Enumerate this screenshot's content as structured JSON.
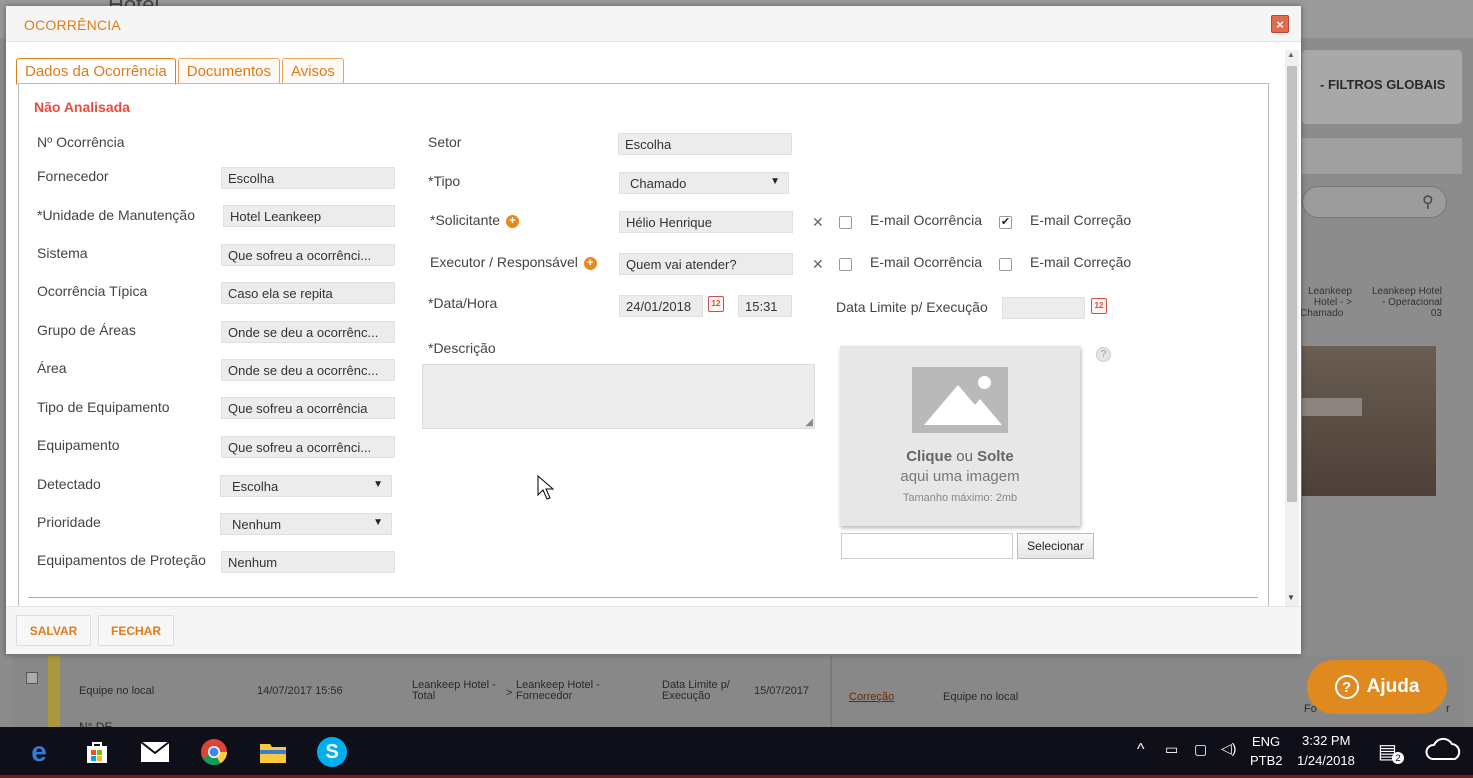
{
  "background": {
    "app_title": "Hotel",
    "filters_label": "- FILTROS GLOBAIS",
    "card_col1": [
      "Leankeep",
      "Hotel - >",
      "Chamado"
    ],
    "card_col2": [
      "Leankeep Hotel",
      "- Operacional",
      "03"
    ],
    "bottom_row": {
      "col1": "Equipe no local",
      "col2": "14/07/2017 15:56",
      "col3": [
        "Leankeep Hotel -",
        "Total"
      ],
      "col3_arrow": ">",
      "col4": [
        "Leankeep Hotel -",
        "Fornecedor"
      ],
      "col5": [
        "Data Limite p/",
        "Execução"
      ],
      "col6": "15/07/2017",
      "col7": "Correção",
      "col8": "Equipe no local",
      "col9": "Fo",
      "col10": "r",
      "cut_text": "N° DE"
    },
    "help_label": "Ajuda"
  },
  "modal": {
    "title": "OCORRÊNCIA",
    "close": "×",
    "tabs": [
      "Dados da Ocorrência",
      "Documentos",
      "Avisos"
    ],
    "status": "Não Analisada",
    "left_fields": [
      {
        "label": "Nº Ocorrência",
        "value": ""
      },
      {
        "label": "Fornecedor",
        "value": "Escolha"
      },
      {
        "label": "*Unidade de Manutenção",
        "value": "Hotel Leankeep"
      },
      {
        "label": "Sistema",
        "value": "Que sofreu a ocorrênci..."
      },
      {
        "label": "Ocorrência Típica",
        "value": "Caso ela se repita"
      },
      {
        "label": "Grupo de Áreas",
        "value": "Onde se deu a ocorrênc..."
      },
      {
        "label": "Área",
        "value": "Onde se deu a ocorrênc..."
      },
      {
        "label": "Tipo de Equipamento",
        "value": "Que sofreu a ocorrência"
      },
      {
        "label": "Equipamento",
        "value": "Que sofreu a ocorrênci..."
      },
      {
        "label": "Detectado",
        "value": "Escolha"
      },
      {
        "label": "Prioridade",
        "value": "Nenhum"
      },
      {
        "label": "Equipamentos de Proteção",
        "value": "Nenhum"
      }
    ],
    "setor_label": "Setor",
    "setor_value": "Escolha",
    "tipo_label": "*Tipo",
    "tipo_value": "Chamado",
    "solicitante_label": "*Solicitante",
    "solicitante_value": "Hélio Henrique",
    "executor_label": "Executor / Responsável",
    "executor_value": "Quem vai atender?",
    "email_ocorrencia": "E-mail Ocorrência",
    "email_correcao": "E-mail Correção",
    "solicitante_email_ocorrencia_checked": false,
    "solicitante_email_correcao_checked": true,
    "executor_email_ocorrencia_checked": false,
    "executor_email_correcao_checked": false,
    "datahora_label": "*Data/Hora",
    "date_value": "24/01/2018",
    "time_value": "15:31",
    "data_limite_label": "Data Limite p/ Execução",
    "data_limite_value": "",
    "descricao_label": "*Descrição",
    "descricao_value": "",
    "image_drop": {
      "line1_bold1": "Clique",
      "line1_mid": " ou ",
      "line1_bold2": "Solte",
      "line2": "aqui uma imagem",
      "line3": "Tamanho máximo: 2mb"
    },
    "help_mark": "?",
    "select_button": "Selecionar",
    "save_button": "SALVAR",
    "close_button": "FECHAR",
    "calendar_icon_text": "12",
    "info_icon_text": "+"
  },
  "taskbar": {
    "language_top": "ENG",
    "language_bottom": "PTB2",
    "time": "3:32 PM",
    "date": "1/24/2018",
    "notification_count": "2"
  },
  "colors": {
    "accent": "#e07b19",
    "status_red": "#e84c3d",
    "close_red": "#e26b4e",
    "help_orange": "#e0891f"
  }
}
